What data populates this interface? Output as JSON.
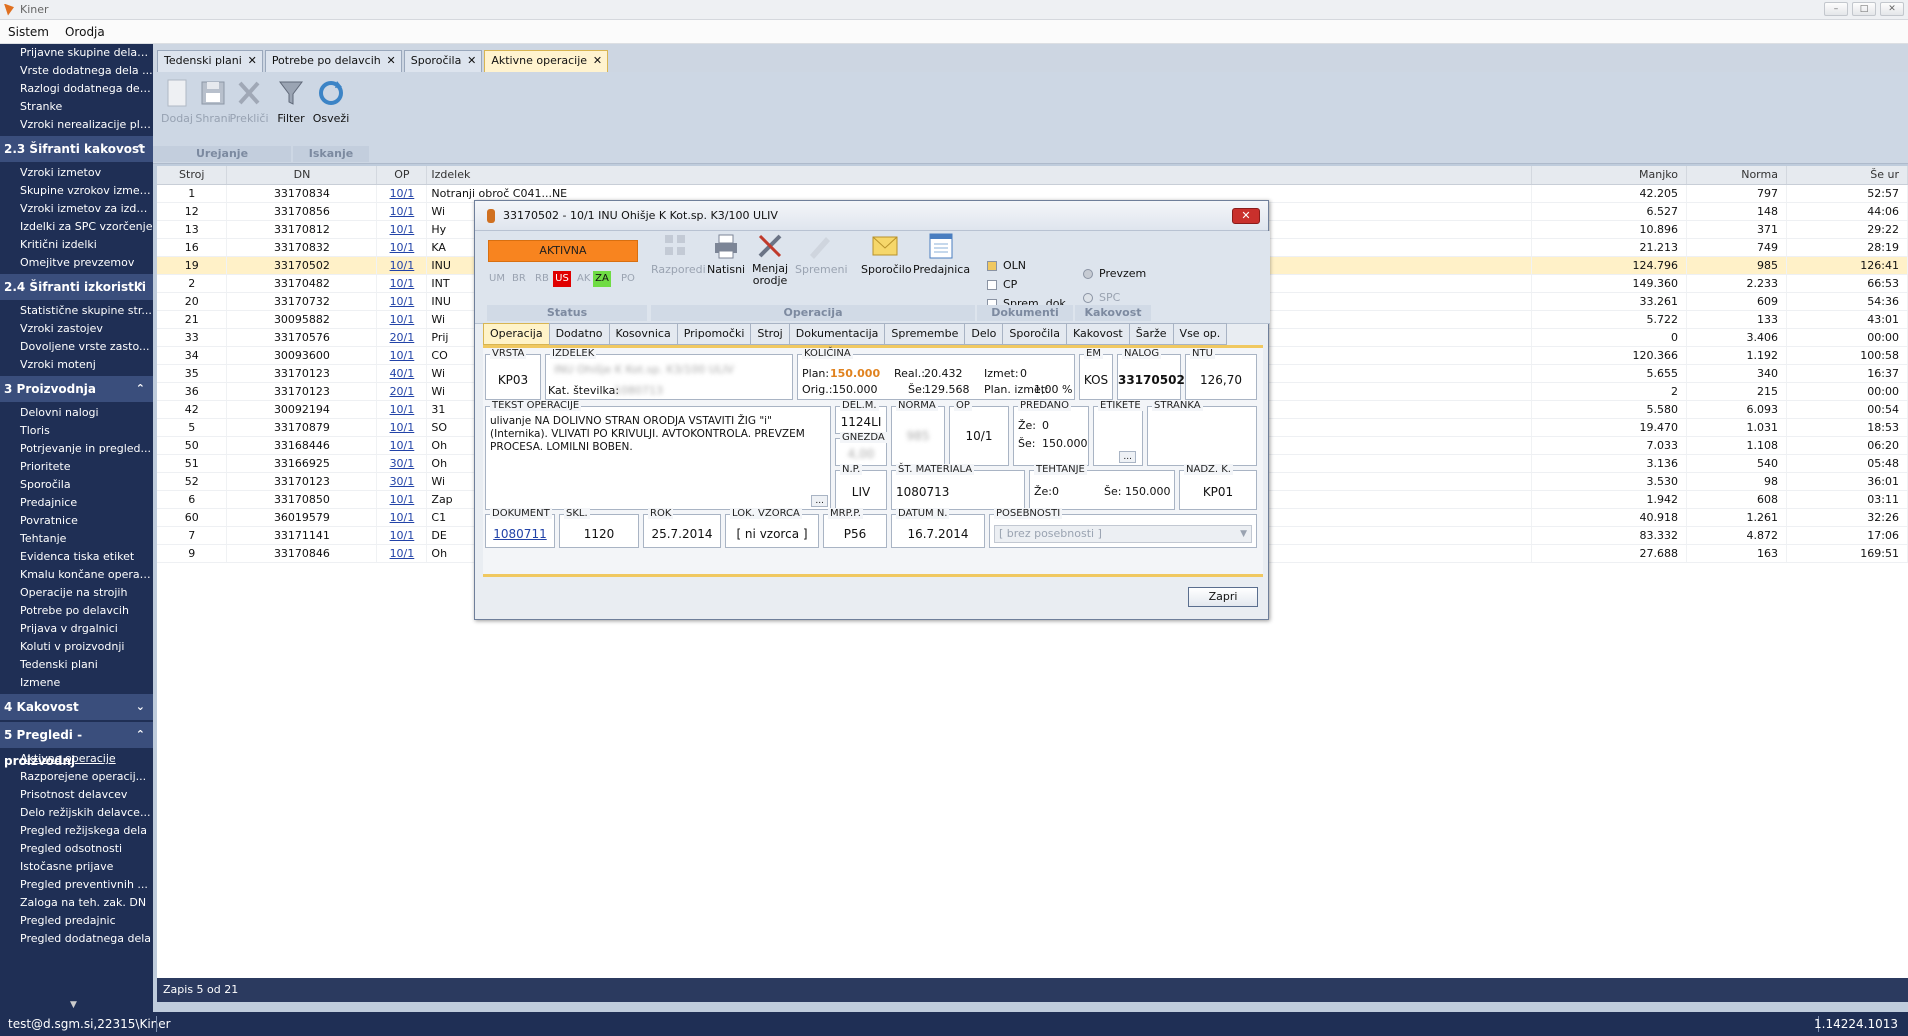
{
  "window": {
    "title": "Kiner"
  },
  "menu": [
    "Sistem",
    "Orodja"
  ],
  "sidebar": {
    "top_items": [
      "Prijavne skupine delavcev",
      "Vrste dodatnega dela ...",
      "Razlogi dodatnega del...",
      "Stranke",
      "Vzroki nerealizacije plana"
    ],
    "sections": [
      {
        "title": "2.3 Šifranti kakovost",
        "chev": "⌃",
        "items": [
          "Vzroki izmetov",
          "Skupine vzrokov izmetov",
          "Vzroki izmetov za izdelke",
          "Izdelki za SPC vzorčenje",
          "Kritični izdelki",
          "Omejitve prevzemov"
        ]
      },
      {
        "title": "2.4 Šifranti izkoristki",
        "chev": "⌃",
        "items": [
          "Statistične skupine str...",
          "Vzroki zastojev",
          "Dovoljene vrste zasto...",
          "Vzroki motenj"
        ]
      },
      {
        "title": "3 Proizvodnja",
        "chev": "⌃",
        "items": [
          "Delovni nalogi",
          "Tloris",
          "Potrjevanje in pregled...",
          "Prioritete",
          "Sporočila",
          "Predajnice",
          "Povratnice",
          "Tehtanje",
          "Evidenca tiska etiket",
          "Kmalu končane operacije",
          "Operacije na strojih",
          "Potrebe po delavcih",
          "Prijava v drgalnici",
          "Koluti v proizvodnji",
          "Tedenski plani",
          "Izmene"
        ]
      },
      {
        "title": "4 Kakovost",
        "chev": "⌄",
        "items": []
      },
      {
        "title": "5 Pregledi - proizvodnj",
        "chev": "⌃",
        "items": [
          "Aktivne operacije",
          "Razporejene operacij...",
          "Prisotnost delavcev",
          "Delo režijskih delavce...",
          "Pregled režijskega dela",
          "Pregled odsotnosti",
          "Istočasne prijave",
          "Pregled preventivnih ...",
          "Zaloga na teh. zak. DN",
          "Pregled predajnic",
          "Pregled dodatnega dela"
        ]
      }
    ]
  },
  "doc_tabs": [
    "Tedenski plani",
    "Potrebe po delavcih",
    "Sporočila",
    "Aktivne operacije"
  ],
  "ribbon": {
    "buttons": [
      "Dodaj",
      "Shrani",
      "Prekliči",
      "Filter",
      "Osveži"
    ],
    "groups": [
      "Urejanje",
      "Iskanje"
    ]
  },
  "grid": {
    "headers": [
      "Stroj",
      "DN",
      "OP",
      "Izdelek",
      "Manjko",
      "Norma",
      "Še ur"
    ],
    "rows": [
      [
        "1",
        "33170834",
        "10/1",
        "Notranji obroč C041...NE",
        "42.205",
        "797",
        "52:57"
      ],
      [
        "12",
        "33170856",
        "10/1",
        "Wi",
        "6.527",
        "148",
        "44:06"
      ],
      [
        "13",
        "33170812",
        "10/1",
        "Hy",
        "10.896",
        "371",
        "29:22"
      ],
      [
        "16",
        "33170832",
        "10/1",
        "KA",
        "21.213",
        "749",
        "28:19"
      ],
      [
        "19",
        "33170502",
        "10/1",
        "INU",
        "124.796",
        "985",
        "126:41"
      ],
      [
        "2",
        "33170482",
        "10/1",
        "INT",
        "149.360",
        "2.233",
        "66:53"
      ],
      [
        "20",
        "33170732",
        "10/1",
        "INU",
        "33.261",
        "609",
        "54:36"
      ],
      [
        "21",
        "30095882",
        "10/1",
        "Wi",
        "5.722",
        "133",
        "43:01"
      ],
      [
        "33",
        "33170576",
        "20/1",
        "Prij",
        "0",
        "3.406",
        "00:00"
      ],
      [
        "34",
        "30093600",
        "10/1",
        "CO",
        "120.366",
        "1.192",
        "100:58"
      ],
      [
        "35",
        "33170123",
        "40/1",
        "Wi",
        "5.655",
        "340",
        "16:37"
      ],
      [
        "36",
        "33170123",
        "20/1",
        "Wi",
        "2",
        "215",
        "00:00"
      ],
      [
        "42",
        "30092194",
        "10/1",
        "31",
        "5.580",
        "6.093",
        "00:54"
      ],
      [
        "5",
        "33170879",
        "10/1",
        "SO",
        "19.470",
        "1.031",
        "18:53"
      ],
      [
        "50",
        "33168446",
        "10/1",
        "Oh",
        "7.033",
        "1.108",
        "06:20"
      ],
      [
        "51",
        "33166925",
        "30/1",
        "Oh",
        "3.136",
        "540",
        "05:48"
      ],
      [
        "52",
        "33170123",
        "30/1",
        "Wi",
        "3.530",
        "98",
        "36:01"
      ],
      [
        "6",
        "33170850",
        "10/1",
        "Zap",
        "1.942",
        "608",
        "03:11"
      ],
      [
        "60",
        "36019579",
        "10/1",
        "C1",
        "40.918",
        "1.261",
        "32:26"
      ],
      [
        "7",
        "33171141",
        "10/1",
        "DE",
        "83.332",
        "4.872",
        "17:06"
      ],
      [
        "9",
        "33170846",
        "10/1",
        "Oh",
        "27.688",
        "163",
        "169:51"
      ]
    ],
    "selected_row": 4,
    "footer": "Zapis 5 od 21"
  },
  "status": {
    "user": "test@d.sgm.si,22315\\Kiner",
    "version": "1.14224.1013"
  },
  "dialog": {
    "title": "33170502 - 10/1 INU  Ohišje K Kot.sp. K3/100     ULIV",
    "close": "✕",
    "status_badge": "AKTIVNA",
    "status_marks": [
      "UM",
      "BR",
      "RB",
      "US",
      "AK",
      "ZA",
      "PO"
    ],
    "buttons": {
      "razporedi": "Razporedi",
      "natisni": "Natisni",
      "menjaj": "Menjaj orodje",
      "spremeni": "Spremeni",
      "sporocilo": "Sporočilo",
      "predajnica": "Predajnica"
    },
    "docs": [
      "OLN",
      "CP",
      "Sprem. dok."
    ],
    "kakovost": [
      "Prevzem",
      "SPC"
    ],
    "groups": [
      "Status",
      "Operacija",
      "Dokumenti",
      "Kakovost"
    ],
    "tabs": [
      "Operacija",
      "Dodatno",
      "Kosovnica",
      "Pripomočki",
      "Stroj",
      "Dokumentacija",
      "Spremembe",
      "Delo",
      "Sporočila",
      "Kakovost",
      "Šarže",
      "Vse op."
    ],
    "fields": {
      "vrsta_lbl": "VRSTA",
      "vrsta": "KP03",
      "izdelek_lbl": "IZDELEK",
      "izdelek": "INU  Ohišje K Kot.sp. K3/100       ULIV",
      "kat_lbl": "Kat. številka:",
      "kat": "1080713",
      "kolicina_lbl": "KOLIČINA",
      "plan_lbl": "Plan:",
      "plan": "150.000",
      "orig_lbl": "Orig.:",
      "orig": "150.000",
      "real_lbl": "Real.:",
      "real": "20.432",
      "se_lbl": "Še:",
      "se": "129.568",
      "izmet_lbl": "Izmet:",
      "izmet": "0",
      "planizmet_lbl": "Plan. izmet:",
      "planizmet": "1,00 %",
      "em_lbl": "EM",
      "em": "KOS",
      "nalog_lbl": "NALOG",
      "nalog": "33170502",
      "ntu_lbl": "NTU",
      "ntu": "126,70",
      "tekst_lbl": "TEKST OPERACIJE",
      "tekst": "ulivanje NA DOLIVNO STRAN ORODJA VSTAVITI ŽIG \"i\" (Internika). VLIVATI PO KRIVULJI. AVTOKONTROLA. PREVZEM PROCESA. LOMILNI BOBEN.",
      "delm_lbl": "DEL.M.",
      "delm": "1124LI",
      "gnezda_lbl": "GNEZDA",
      "gnezda": "4,00",
      "norma_lbl": "NORMA",
      "norma": "985",
      "op_lbl": "OP",
      "op": "10/1",
      "predano_lbl": "PREDANO",
      "ze_lbl": "Že:",
      "ze": "0",
      "se2_lbl": "Še:",
      "se2": "150.000",
      "etikete_lbl": "ETIKETE",
      "stranka_lbl": "STRANKA",
      "np_lbl": "N.P.",
      "np": "LIV",
      "stmat_lbl": "ŠT. MATERIALA",
      "stmat": "1080713",
      "tehtanje_lbl": "TEHTANJE",
      "tze": "Že:0",
      "tse": "Še: 150.000",
      "nadzk_lbl": "NADZ. K.",
      "nadzk": "KP01",
      "dokument_lbl": "DOKUMENT",
      "dokument": "1080711",
      "skl_lbl": "SKL.",
      "skl": "1120",
      "rok_lbl": "ROK",
      "rok": "25.7.2014",
      "lokv_lbl": "LOK. VZORCA",
      "lokv": "[ ni vzorca ]",
      "mrpp_lbl": "MRP.P.",
      "mrpp": "P56",
      "datumn_lbl": "DATUM N.",
      "datumn": "16.7.2014",
      "posebnosti_lbl": "POSEBNOSTI",
      "posebnosti": "[ brez posebnosti ]"
    },
    "zapri": "Zapri"
  }
}
